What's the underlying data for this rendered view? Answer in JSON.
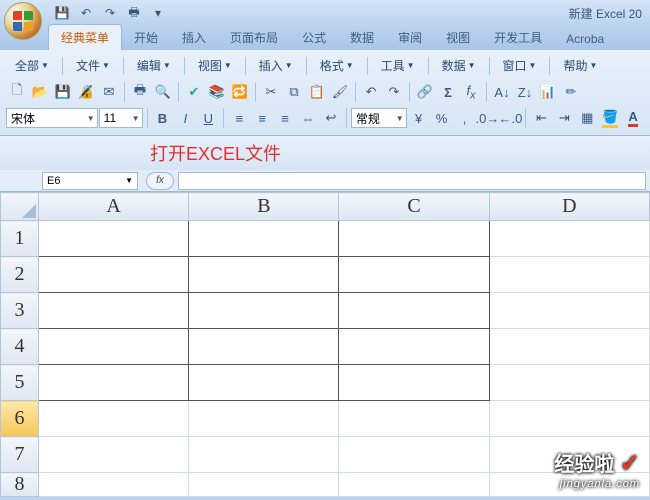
{
  "window": {
    "title": "新建 Excel 20"
  },
  "qat": {
    "save_tip": "保存",
    "undo_tip": "撤销",
    "redo_tip": "恢复",
    "print_tip": "打印"
  },
  "tabs": [
    {
      "label": "经典菜单",
      "active": true
    },
    {
      "label": "开始",
      "active": false
    },
    {
      "label": "插入",
      "active": false
    },
    {
      "label": "页面布局",
      "active": false
    },
    {
      "label": "公式",
      "active": false
    },
    {
      "label": "数据",
      "active": false
    },
    {
      "label": "审阅",
      "active": false
    },
    {
      "label": "视图",
      "active": false
    },
    {
      "label": "开发工具",
      "active": false
    },
    {
      "label": "Acroba",
      "active": false
    }
  ],
  "menus": [
    {
      "label": "全部"
    },
    {
      "label": "文件"
    },
    {
      "label": "编辑"
    },
    {
      "label": "视图"
    },
    {
      "label": "插入"
    },
    {
      "label": "格式"
    },
    {
      "label": "工具"
    },
    {
      "label": "数据"
    },
    {
      "label": "窗口"
    },
    {
      "label": "帮助"
    }
  ],
  "toolbar1": {
    "icons": [
      "new-icon",
      "open-icon",
      "save-icon",
      "mail-icon",
      "print-icon",
      "preview-icon",
      "spell-icon",
      "research-icon",
      "cut-icon",
      "copy-icon",
      "paste-icon",
      "format-painter-icon",
      "undo-icon",
      "redo-icon",
      "hyperlink-icon",
      "autosum-icon",
      "fx-icon",
      "sort-asc-icon",
      "sort-desc-icon",
      "chart-icon"
    ]
  },
  "toolbar2": {
    "font": "宋体",
    "size": "11",
    "number_format": "常规",
    "bold": "B",
    "italic": "I",
    "underline": "U"
  },
  "annotation": "打开EXCEL文件",
  "namebox": {
    "ref": "E6"
  },
  "fx_label": "fx",
  "columns": [
    "A",
    "B",
    "C",
    "D"
  ],
  "rows": [
    "1",
    "2",
    "3",
    "4",
    "5",
    "6",
    "7",
    "8"
  ],
  "active_row": "6",
  "bordered_range": {
    "rows": [
      "1",
      "2",
      "3",
      "4",
      "5"
    ],
    "cols": [
      "A",
      "B",
      "C"
    ]
  },
  "watermark": {
    "line1": "经验啦",
    "check": "✓",
    "line2": "jingyanla.com"
  }
}
